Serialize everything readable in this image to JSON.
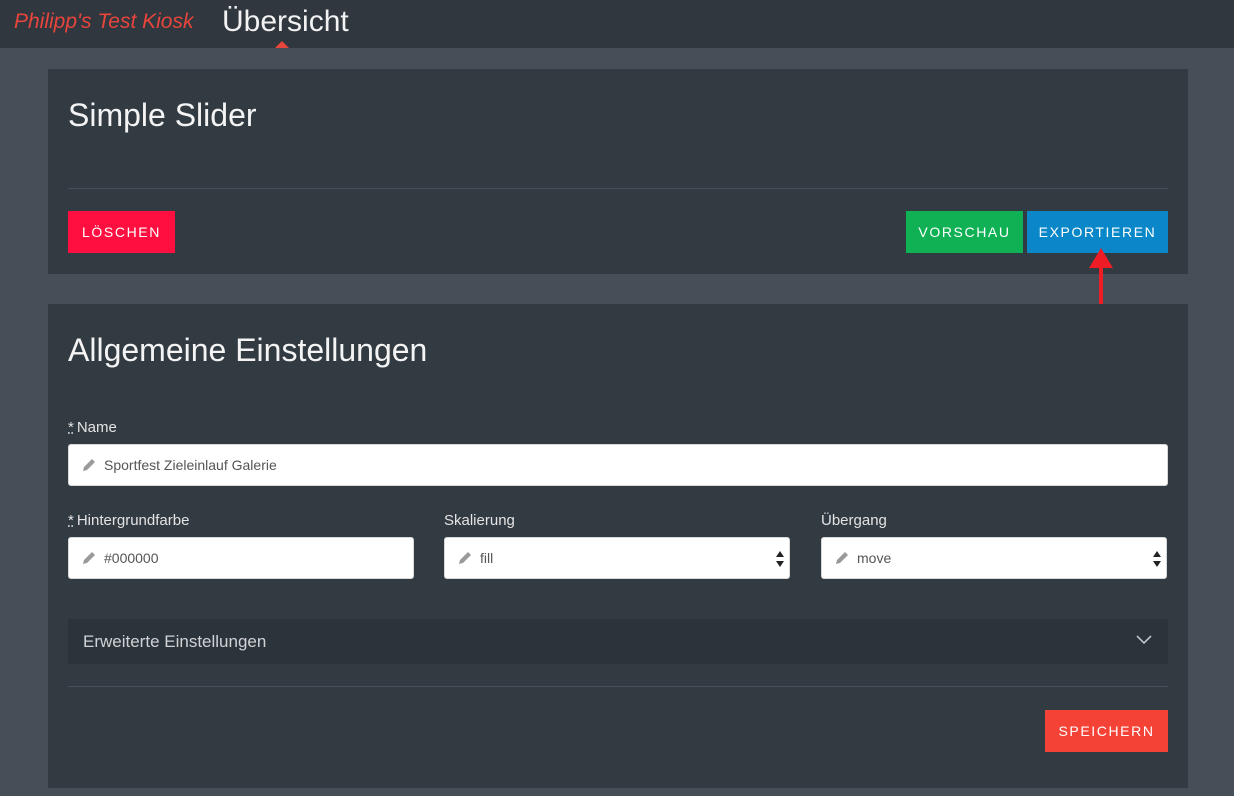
{
  "header": {
    "brand": "Philipp's Test Kiosk",
    "active_nav": "Übersicht"
  },
  "slider_card": {
    "title": "Simple Slider",
    "delete_label": "LÖSCHEN",
    "preview_label": "VORSCHAU",
    "export_label": "EXPORTIEREN"
  },
  "settings_card": {
    "title": "Allgemeine Einstellungen",
    "name_required": "*",
    "name_label": "Name",
    "name_value": "Sportfest Zieleinlauf Galerie",
    "bg_required": "*",
    "bg_label": "Hintergrundfarbe",
    "bg_value": "#000000",
    "scale_label": "Skalierung",
    "scale_value": "fill",
    "transition_label": "Übergang",
    "transition_value": "move",
    "advanced_label": "Erweiterte Einstellungen",
    "save_label": "SPEICHERN"
  },
  "icons": {
    "field_icon": "pencil-icon",
    "select_icon": "select-arrows-icon",
    "advanced_icon": "chevron-down-icon",
    "annotation": "red-arrow-up-icon"
  },
  "colors": {
    "brand": "#e8453c",
    "delete": "#ff0f3f",
    "preview": "#0fb154",
    "export": "#0a87c8",
    "save": "#f44336"
  }
}
